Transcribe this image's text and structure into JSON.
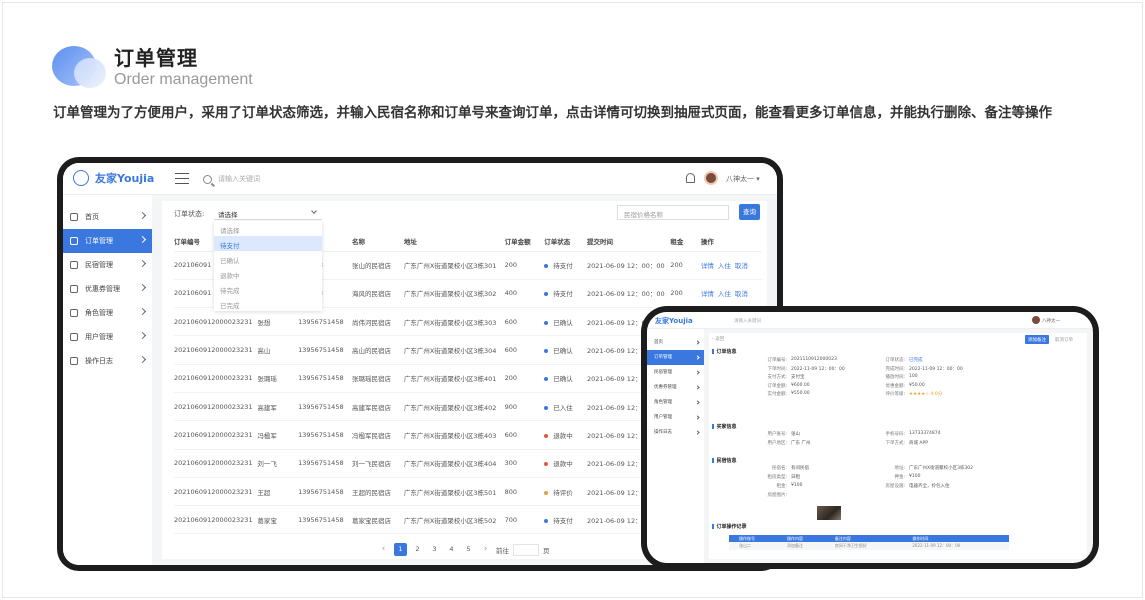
{
  "header": {
    "title": "订单管理",
    "subtitle": "Order management",
    "description": "订单管理为了方便用户，采用了订单状态筛选，并输入民宿名称和订单号来查询订单，点击详情可切换到抽屉式页面，能查看更多订单信息，并能执行删除、备注等操作"
  },
  "laptop": {
    "brand": "友家Youjia",
    "search_placeholder": "请输入关键词",
    "user_name": "八神太一",
    "sidebar": [
      {
        "label": "首页",
        "icon": "home-icon",
        "active": false
      },
      {
        "label": "订单管理",
        "icon": "order-icon",
        "active": true
      },
      {
        "label": "民宿管理",
        "icon": "house-icon",
        "active": false
      },
      {
        "label": "优惠券管理",
        "icon": "coupon-icon",
        "active": false
      },
      {
        "label": "角色管理",
        "icon": "role-icon",
        "active": false
      },
      {
        "label": "用户管理",
        "icon": "user-icon",
        "active": false
      },
      {
        "label": "操作日志",
        "icon": "gear-icon",
        "active": false
      }
    ],
    "filter": {
      "label": "订单状态:",
      "selected": "请选择",
      "options": [
        "请选择",
        "待支付",
        "已确认",
        "退款中",
        "待完成",
        "已完成"
      ],
      "highlighted": "待支付",
      "name_placeholder": "民宿价格名称",
      "query_button": "查询"
    },
    "table": {
      "columns": [
        "订单编号",
        "",
        "号",
        "名称",
        "地址",
        "订单金额",
        "订单状态",
        "提交时间",
        "租金",
        "操作"
      ],
      "rows": [
        {
          "id": "202106091",
          "name": "",
          "phone": "751458",
          "homestay": "张山的民宿店",
          "address": "广东广州X街道聚校小区3栋301",
          "amount": "200",
          "status": "待支付",
          "color": "#3a78e0",
          "time": "2021-06-09 12：00：00",
          "rent": "200",
          "actions": [
            "详情",
            "入住",
            "取消"
          ]
        },
        {
          "id": "202106091",
          "name": "",
          "phone": "751458",
          "homestay": "海风的民宿店",
          "address": "广东广州X街道聚校小区3栋302",
          "amount": "400",
          "status": "待支付",
          "color": "#3a78e0",
          "time": "2021-06-09 12：00：00",
          "rent": "200",
          "actions": [
            "详情",
            "入住",
            "取消"
          ]
        },
        {
          "id": "20210609120000232​31",
          "name": "张想",
          "phone": "13956751458",
          "homestay": "尚伟河民宿店",
          "address": "广东广州X街道聚校小区3栋303",
          "amount": "600",
          "status": "已确认",
          "color": "#3a78e0",
          "time": "2021-06-09 12：00：00",
          "rent": "",
          "actions": []
        },
        {
          "id": "2021060912000023231",
          "name": "高山",
          "phone": "13956751458",
          "homestay": "高山的民宿店",
          "address": "广东广州X街道聚校小区3栋304",
          "amount": "600",
          "status": "已确认",
          "color": "#3a78e0",
          "time": "2021-06-09 12：00：00",
          "rent": "",
          "actions": []
        },
        {
          "id": "2021060912000023231",
          "name": "张璐瑶",
          "phone": "13956751458",
          "homestay": "张璐瑶民宿店",
          "address": "广东广州X街道聚校小区3栋401",
          "amount": "200",
          "status": "已确认",
          "color": "#3a78e0",
          "time": "2021-06-09 12：00：00",
          "rent": "",
          "actions": []
        },
        {
          "id": "2021060912000023231",
          "name": "高建军",
          "phone": "13956751458",
          "homestay": "高建军民宿店",
          "address": "广东广州X街道聚校小区3栋402",
          "amount": "900",
          "status": "已入住",
          "color": "#3a78e0",
          "time": "2021-06-09 12：00：00",
          "rent": "",
          "actions": []
        },
        {
          "id": "2021060912000023231",
          "name": "冯楹军",
          "phone": "13956751458",
          "homestay": "冯楹军民宿店",
          "address": "广东广州X街道聚校小区3栋403",
          "amount": "600",
          "status": "退款中",
          "color": "#e05a3a",
          "time": "2021-06-09 12：00：00",
          "rent": "",
          "actions": []
        },
        {
          "id": "2021060912000023231",
          "name": "刘一飞",
          "phone": "13956751458",
          "homestay": "刘一飞民宿店",
          "address": "广东广州X街道聚校小区3栋404",
          "amount": "300",
          "status": "退款中",
          "color": "#e05a3a",
          "time": "2021-06-09 12：00：00",
          "rent": "",
          "actions": []
        },
        {
          "id": "2021060912000023231",
          "name": "王超",
          "phone": "13956751458",
          "homestay": "王超的民宿店",
          "address": "广东广州X街道聚校小区3栋501",
          "amount": "800",
          "status": "待评价",
          "color": "#e0a23a",
          "time": "2021-06-09 12：00：00",
          "rent": "",
          "actions": []
        },
        {
          "id": "2021060912000023231",
          "name": "葛家宝",
          "phone": "13956751458",
          "homestay": "葛家宝民宿店",
          "address": "广东广州X街道聚校小区3栋502",
          "amount": "700",
          "status": "待支付",
          "color": "#3a78e0",
          "time": "2021-06-09 12：00：00",
          "rent": "",
          "actions": []
        }
      ]
    },
    "pager": {
      "pages": [
        "1",
        "2",
        "3",
        "4",
        "5"
      ],
      "current": "1",
      "goto_label": "前往",
      "page_unit": "页"
    }
  },
  "tablet": {
    "brand": "友家Youjia",
    "search_placeholder": "请输入关键词",
    "user_name": "八神太一",
    "sidebar": [
      "首页",
      "订单管理",
      "民宿管理",
      "优惠券管理",
      "角色管理",
      "用户管理",
      "操作日志"
    ],
    "back": "返回",
    "btn_primary": "添加备注",
    "btn_secondary": "取消订单",
    "sections": {
      "order": "订单信息",
      "buyer": "买家信息",
      "homestay": "民宿信息",
      "log": "订单操作记录"
    },
    "order_fields": [
      [
        "订单编号:",
        "2021110912000023"
      ],
      [
        "订单状态:",
        "已完成"
      ],
      [
        "下单时间:",
        "2022-11-09 12：00：00"
      ],
      [
        "完成时间:",
        "2022-11-09 12：00：00"
      ],
      [
        "支付方式:",
        "支付宝"
      ],
      [
        "播放时间:",
        "100"
      ],
      [
        "订单金额:",
        "¥600.00"
      ],
      [
        "优惠金额:",
        "¥50.00"
      ],
      [
        "实付金额:",
        "¥550.00"
      ],
      [
        "评价等级:",
        "★★★★☆ 4.0分"
      ]
    ],
    "buyer_fields": [
      [
        "用户账号:",
        "张山"
      ],
      [
        "手机号码:",
        "13733374874"
      ],
      [
        "用户地区:",
        "广东 广州"
      ],
      [
        "下单方式:",
        "商城 APP"
      ]
    ],
    "homestay_fields": [
      [
        "民宿名:",
        "有间民宿"
      ],
      [
        "地址:",
        "广东广州X街道聚校小区3栋302"
      ],
      [
        "租房类型:",
        "日租"
      ],
      [
        "押金:",
        "¥100"
      ],
      [
        "租金:",
        "¥100"
      ],
      [
        "房屋设施:",
        "电器齐全，拎包入住"
      ],
      [
        "房屋图片:",
        ""
      ]
    ],
    "log_table": {
      "columns": [
        "操作账号",
        "操作内容",
        "备注内容",
        "操作时间"
      ],
      "row": [
        "张山二",
        "添加备注",
        "房间干净卫生很好",
        "2022-11-09 12：00：00"
      ]
    }
  }
}
